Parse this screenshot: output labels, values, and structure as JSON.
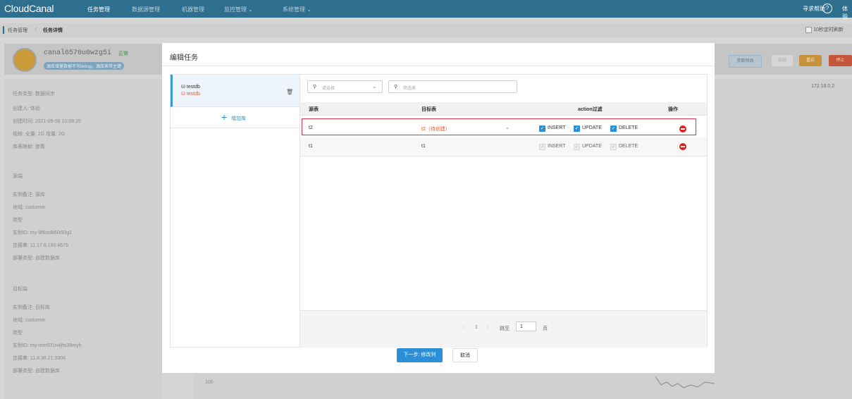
{
  "nav": {
    "logo": "CloudCanal",
    "items": [
      "任务管理",
      "数据源管理",
      "机器管理",
      "监控管理 ⌄",
      "系统管理 ⌄"
    ],
    "help": "寻求帮助",
    "user": "体验"
  },
  "breadcrumb": {
    "root": "任务管理",
    "sep": "/",
    "current": "任务详情",
    "refresh": "10秒定时刷新"
  },
  "task": {
    "name": "canal6570u0wzg5i",
    "status": "正常",
    "warning": "源库增量数据不写binlog，源库表带主键",
    "buttons": [
      "参数修改",
      "启动",
      "重启",
      "停止"
    ],
    "ip": "172.18.0.2",
    "info": [
      "任务类型: 数据同步",
      "创建人: 体验",
      "创建时间: 2021-09-08 10:08:25",
      "规格: 全量: 2G 增量: 2G",
      "库表映射: 查看"
    ],
    "source_title": "源端",
    "source": [
      "实例备注: 源库",
      "地域: customer",
      "类型:",
      "实例ID: my-9f6cn8i60i93g1",
      "连接串: 11.17.6.185:4679",
      "部署类型: 自建数据库"
    ],
    "target_title": "目标端",
    "target": [
      "实例备注: 目标库",
      "地域: customer",
      "类型:",
      "实例ID: my-mm931n4jhs39myh",
      "连接串: 11.8.36.21:3306",
      "部署类型: 自建数据库"
    ],
    "chart_tick": "100"
  },
  "modal": {
    "title": "编辑任务",
    "db": {
      "source_name": "testdb",
      "target_name": "testdb",
      "add_label": "增加库"
    },
    "filters": {
      "schema_placeholder": "请选择",
      "table_placeholder": "筛选表"
    },
    "columns": {
      "source": "源表",
      "target": "目标表",
      "action": "action过滤",
      "op": "操作"
    },
    "rows": [
      {
        "source": "t2",
        "target": "t2（待创建）",
        "actions": [
          "INSERT",
          "UPDATE",
          "DELETE"
        ],
        "checked": true
      },
      {
        "source": "t1",
        "target": "t1",
        "actions": [
          "INSERT",
          "UPDATE",
          "DELETE"
        ],
        "checked": false
      }
    ],
    "pager": {
      "current": "1",
      "jump_label": "跳至",
      "jump_value": "1",
      "page_suffix": "页"
    },
    "next_button": "下一步: 修改列",
    "cancel_button": "取消"
  },
  "colors": {
    "nav": "#2e6e8e",
    "accent": "#2a8fd6",
    "highlight": "#d33548",
    "delete": "#e02020",
    "pending": "#e05a2b"
  }
}
